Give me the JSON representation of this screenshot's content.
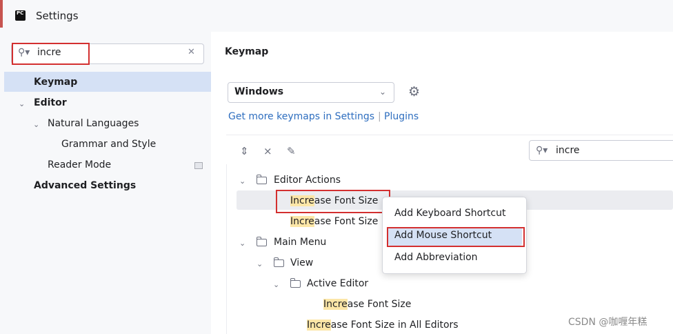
{
  "window": {
    "title": "Settings",
    "app_icon": "pycharm-icon"
  },
  "sidebar": {
    "search": {
      "value": "incre",
      "search_icon": "search-icon",
      "clear_icon": "close-icon"
    },
    "items": [
      {
        "label": "Keymap",
        "selected": true,
        "bold": true
      },
      {
        "label": "Editor",
        "bold": true,
        "expanded": true
      },
      {
        "label": "Natural Languages",
        "expanded": true
      },
      {
        "label": "Grammar and Style"
      },
      {
        "label": "Reader Mode",
        "icon": "project-scope-icon"
      },
      {
        "label": "Advanced Settings",
        "bold": true
      }
    ]
  },
  "main": {
    "title": "Keymap",
    "keymap_select": {
      "value": "Windows"
    },
    "links": {
      "get_more": "Get more keymaps in Settings",
      "sep": "|",
      "plugins": "Plugins"
    },
    "toolbar": {
      "icons": [
        "expand-all-icon",
        "collapse-all-icon",
        "edit-shortcut-icon"
      ]
    },
    "action_search": {
      "value": "incre"
    },
    "tree": {
      "editor_actions": "Editor Actions",
      "row1_hl": "Incre",
      "row1_rest": "ase Font Size",
      "row2_hl": "Incre",
      "row2_rest": "ase Font Size",
      "main_menu": "Main Menu",
      "view": "View",
      "active_editor": "Active Editor",
      "row3_hl": "Incre",
      "row3_rest": "ase Font Size",
      "row4_hl": "Incre",
      "row4_rest": "ase Font Size in All Editors"
    },
    "context_menu": {
      "items": [
        "Add Keyboard Shortcut",
        "Add Mouse Shortcut",
        "Add Abbreviation"
      ],
      "selected_index": 1
    }
  },
  "watermark": "CSDN @咖喱年糕",
  "colors": {
    "accent": "#2e6ebf",
    "selection": "#d5e1f5",
    "highlight": "#fce6a7",
    "annotation": "#d32f2f"
  }
}
